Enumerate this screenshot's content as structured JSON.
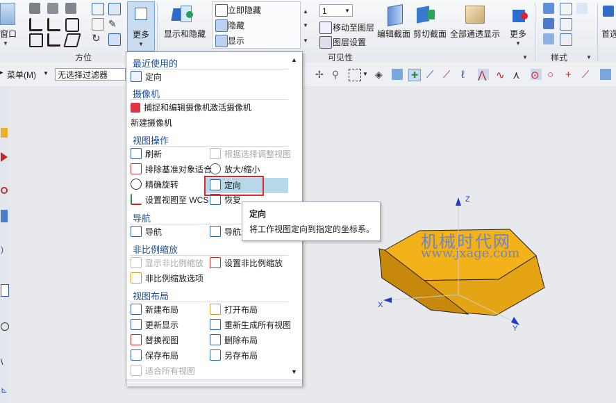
{
  "ribbon": {
    "window_label": "窗口",
    "orient_group_label": "方位",
    "more_label": "更多",
    "show_hide_label": "显示和隐藏",
    "immediate_hide_label": "立即隐藏",
    "hide_label": "隐藏",
    "show_label": "显示",
    "layer_value": "1",
    "move_to_layer_label": "移动至图层",
    "layer_settings_label": "图层设置",
    "visibility_group_label": "可见性",
    "edit_section_label": "编辑截面",
    "clip_section_label": "剪切截面",
    "show_all_through_label": "全部通透显示",
    "more_label2": "更多",
    "style_group_label": "样式",
    "first_label_right": "首选"
  },
  "toolbar2": {
    "menu_label": "菜单(M)",
    "filter_value": "无选择过滤器"
  },
  "menu": {
    "recent_header": "最近使用的",
    "recent_items": [
      "定向"
    ],
    "camera_header": "摄像机",
    "camera_items": [
      "捕捉和编辑摄像机",
      "激活摄像机",
      "新建摄像机"
    ],
    "view_ops_header": "视图操作",
    "view_ops": {
      "refresh": "刷新",
      "adjust_by_selection": "根据选择调整视图",
      "fit_exclude_datum": "排除基准对象适合",
      "zoom": "放大/缩小",
      "precise_rotate": "精确旋转",
      "orient": "定向",
      "set_view_to_wcs": "设置视图至 WCS",
      "restore": "恢复"
    },
    "nav_header": "导航",
    "nav_items": [
      "导航",
      "导航选"
    ],
    "nonscale_header": "非比例缩放",
    "nonscale_items": [
      "显示非比例缩放",
      "设置非比例缩放",
      "非比例缩放选项"
    ],
    "layout_header": "视图布局",
    "layout_items": [
      "新建布局",
      "打开布局",
      "更新显示",
      "重新生成所有视图",
      "替换视图",
      "删除布局",
      "保存布局",
      "另存布局",
      "适合所有视图"
    ]
  },
  "tooltip": {
    "title": "定向",
    "body": "将工作视图定向到指定的坐标系。"
  },
  "viewport": {
    "axis_x": "X",
    "axis_y": "Y",
    "axis_z": "Z",
    "watermark_cn": "机械时代网",
    "watermark_url": "www.jxage.com"
  },
  "colors": {
    "accent": "#1f4e9a",
    "highlight": "#b7d8e8",
    "red_frame": "#e0242c",
    "part_face": "#f3b21a",
    "part_side": "#d69510"
  }
}
